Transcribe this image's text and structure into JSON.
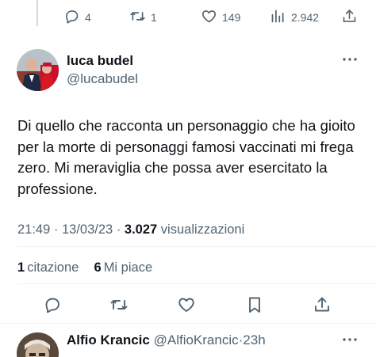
{
  "previous_tweet": {
    "replies": "4",
    "retweets": "1",
    "likes": "149",
    "views": "2.942"
  },
  "post": {
    "author_name": "luca budel",
    "author_handle": "@lucabudel",
    "text": "Di quello che racconta un personaggio che ha gioito per la morte di personaggi famosi vaccinati mi frega zero. Mi meraviglia che possa aver esercitato la professione.",
    "time": "21:49",
    "date": "13/03/23",
    "views_count": "3.027",
    "views_label": "visualizzazioni",
    "quotes_count": "1",
    "quotes_label": "citazione",
    "likes_count": "6",
    "likes_label": "Mi piace"
  },
  "reply": {
    "author_name": "Alfio Krancic",
    "author_handle": "@AlfioKrancic",
    "age": "23h"
  },
  "icons": {
    "reply": "comment-icon",
    "retweet": "retweet-icon",
    "like": "heart-icon",
    "views": "analytics-icon",
    "share": "share-icon",
    "bookmark": "bookmark-icon",
    "more": "more-dots-icon"
  },
  "colors": {
    "text": "#0f1419",
    "secondary": "#536471",
    "divider": "#eff3f4"
  }
}
